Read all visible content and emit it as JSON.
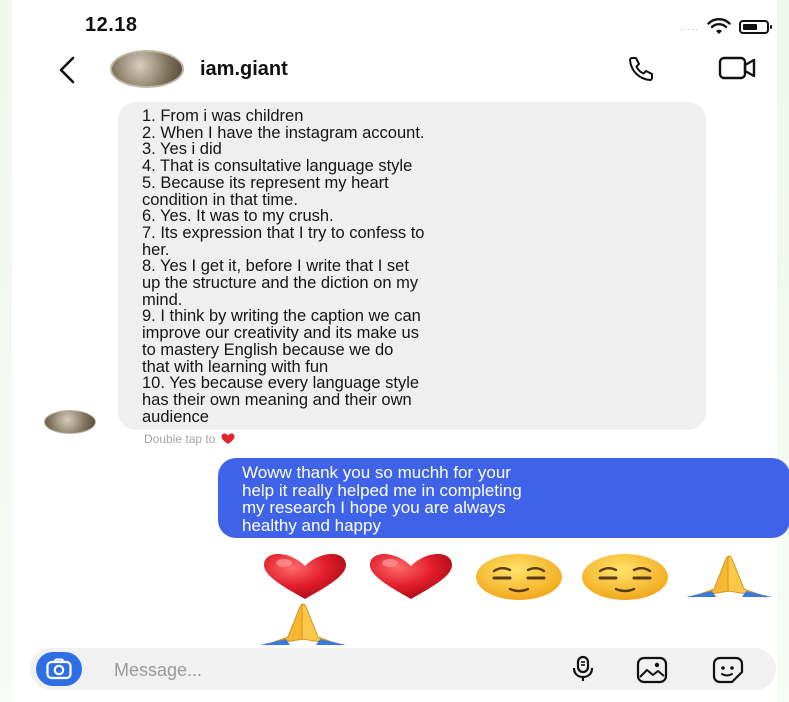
{
  "status_bar": {
    "time": "12.18",
    "signal_text": "....."
  },
  "header": {
    "username": "iam.giant"
  },
  "messages": {
    "received": {
      "lines": [
        "1. From i was children",
        "2. When I have the instagram account.",
        "3. Yes i did",
        "4. That is consultative language style",
        "5. Because its represent my heart",
        "condition in that time.",
        "6. Yes. It was to my crush.",
        "7. Its expression that I try to confess to",
        "her.",
        "8. Yes I get it, before I write that I set",
        "up the structure and the diction on my",
        "mind.",
        "9. I think by writing the caption we can",
        "improve our creativity and its make us",
        "to mastery English because we do",
        "that with learning with fun",
        "10. Yes because every language style",
        "has their own meaning and their own",
        "audience"
      ],
      "hint": "Double tap to"
    },
    "sent": {
      "lines": [
        "Woww thank you so muchh for your",
        "help it really helped me in completing",
        "my research I hope you are always",
        "healthy and happy"
      ]
    },
    "emojis": [
      "red-heart",
      "red-heart",
      "relieved-face",
      "relieved-face",
      "folded-hands",
      "folded-hands"
    ]
  },
  "composer": {
    "placeholder": "Message..."
  },
  "colors": {
    "sent_bubble": "#3f63e8",
    "received_bubble": "#efefef",
    "camera_button": "#2f6fe6"
  }
}
